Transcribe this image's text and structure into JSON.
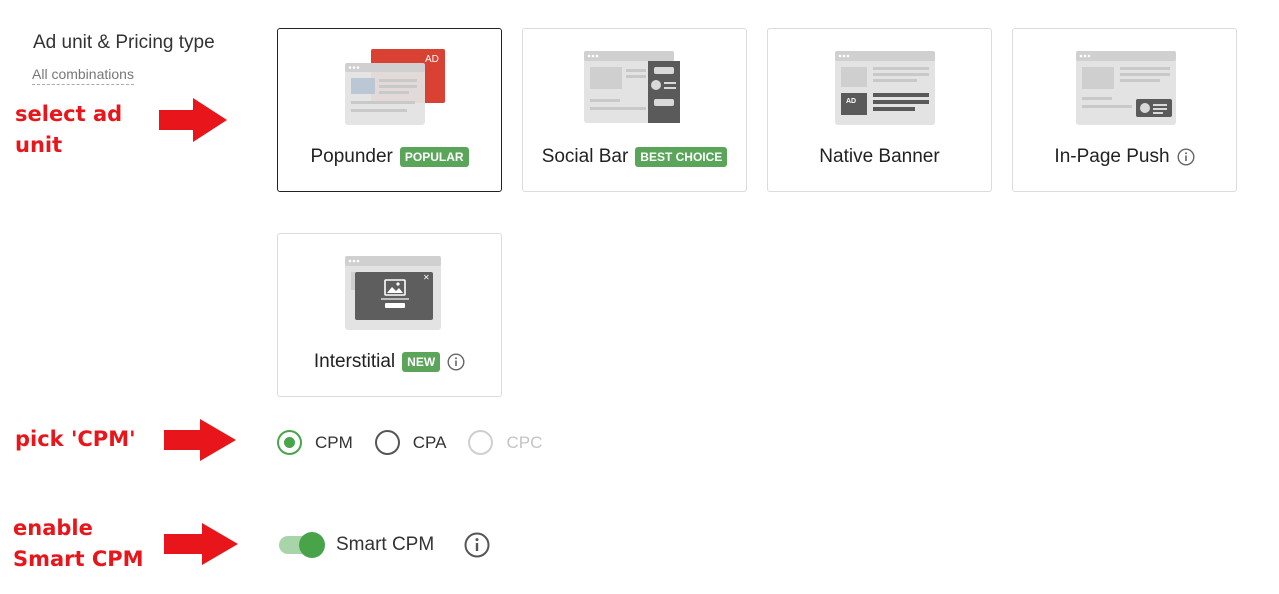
{
  "section": {
    "title": "Ad unit & Pricing type",
    "link": "All combinations"
  },
  "annotations": {
    "select_ad": "select ad",
    "select_unit": "unit",
    "pick_cpm": "pick 'CPM'",
    "enable": "enable",
    "smart_cpm": "Smart CPM",
    "color": "#e8161a"
  },
  "ad_units": [
    {
      "label": "Popunder",
      "badge": "POPULAR",
      "selected": true,
      "icon": "popunder-illustration"
    },
    {
      "label": "Social Bar",
      "badge": "BEST CHOICE",
      "selected": false,
      "icon": "social-bar-illustration"
    },
    {
      "label": "Native Banner",
      "badge": "",
      "selected": false,
      "icon": "native-banner-illustration"
    },
    {
      "label": "In-Page Push",
      "badge": "",
      "selected": false,
      "icon": "in-page-push-illustration",
      "info": "info-icon"
    },
    {
      "label": "Interstitial",
      "badge": "NEW",
      "selected": false,
      "icon": "interstitial-illustration",
      "info": "info-icon"
    }
  ],
  "illustration_badge": "AD",
  "pricing": {
    "options": [
      {
        "label": "CPM",
        "checked": true,
        "disabled": false
      },
      {
        "label": "CPA",
        "checked": false,
        "disabled": false
      },
      {
        "label": "CPC",
        "checked": false,
        "disabled": true
      }
    ]
  },
  "smart_cpm": {
    "label": "Smart CPM",
    "enabled": true
  },
  "colors": {
    "accent_green": "#4aa44a",
    "badge_green": "#5aa55a",
    "popunder_red": "#d94133"
  }
}
